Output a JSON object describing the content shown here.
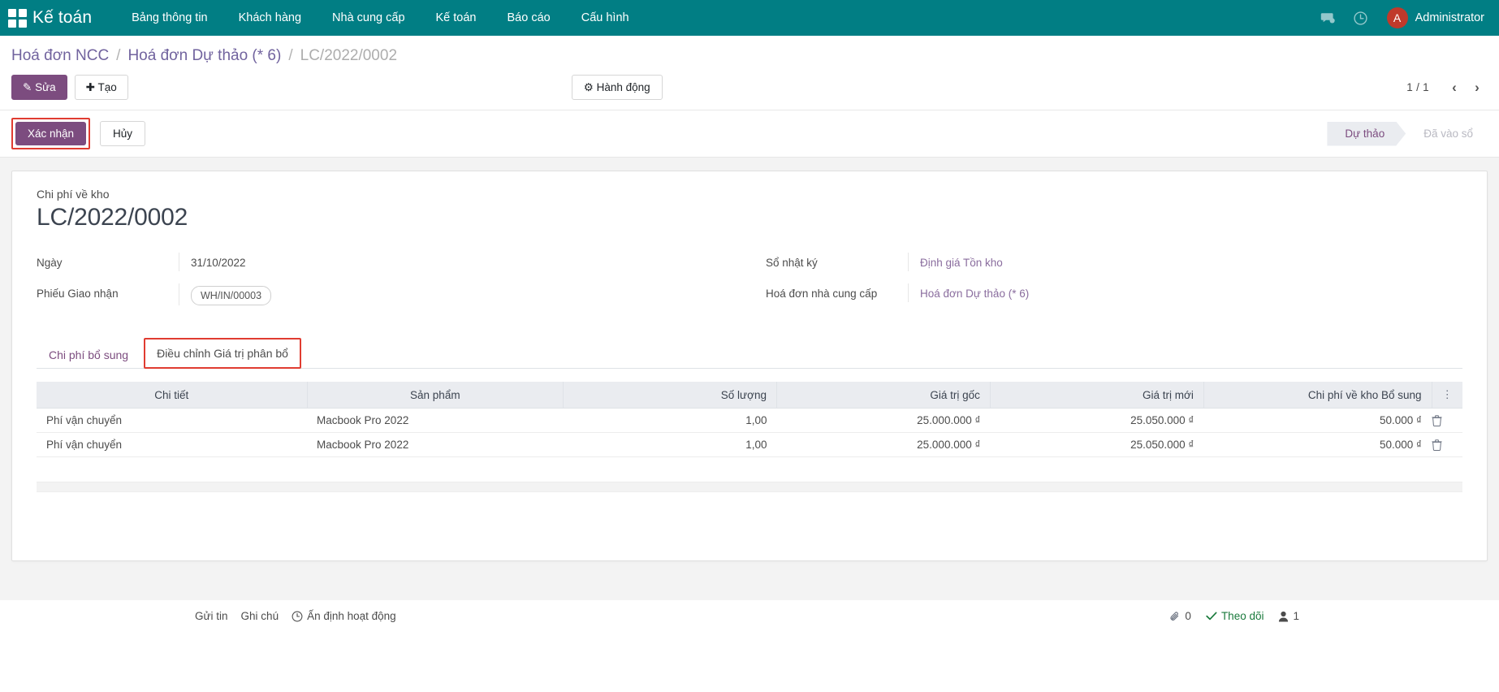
{
  "navbar": {
    "brand": "Kế toán",
    "apps_icon": "apps-grid-icon",
    "menu": [
      {
        "label": "Bảng thông tin"
      },
      {
        "label": "Khách hàng"
      },
      {
        "label": "Nhà cung cấp"
      },
      {
        "label": "Kế toán"
      },
      {
        "label": "Báo cáo"
      },
      {
        "label": "Cấu hình"
      }
    ],
    "messages_icon": "chat-bubble-icon",
    "activities_icon": "clock-icon",
    "avatar_initial": "A",
    "user_name": "Administrator",
    "bg_color": "#017e84",
    "avatar_color": "#c0392b"
  },
  "breadcrumb": {
    "items": [
      {
        "label": "Hoá đơn NCC",
        "current": false
      },
      {
        "label": "Hoá đơn Dự thảo (* 6)",
        "current": false
      },
      {
        "label": "LC/2022/0002",
        "current": true
      }
    ],
    "separator": "/"
  },
  "toolbar": {
    "edit_label": "Sửa",
    "edit_icon": "pencil-icon",
    "create_label": "Tạo",
    "create_icon": "plus-icon",
    "action_label": "Hành động",
    "action_icon": "gear-icon",
    "pager_count": "1 / 1",
    "pager_prev_icon": "chevron-left-icon",
    "pager_next_icon": "chevron-right-icon"
  },
  "statusbar": {
    "confirm_label": "Xác nhận",
    "cancel_label": "Hủy",
    "highlight_color": "#e03c31",
    "stages": [
      {
        "label": "Dự thảo",
        "active": true
      },
      {
        "label": "Đã vào sổ",
        "active": false
      }
    ]
  },
  "form": {
    "sublabel": "Chi phí về kho",
    "title": "LC/2022/0002",
    "left_fields": [
      {
        "label": "Ngày",
        "value": "31/10/2022",
        "type": "text"
      },
      {
        "label": "Phiếu Giao nhận",
        "value": "WH/IN/00003",
        "type": "badge"
      }
    ],
    "right_fields": [
      {
        "label": "Sổ nhật ký",
        "value": "Định giá Tồn kho",
        "type": "link"
      },
      {
        "label": "Hoá đơn nhà cung cấp",
        "value": "Hoá đơn Dự thảo (* 6)",
        "type": "link"
      }
    ]
  },
  "tabs": [
    {
      "label": "Chi phí bổ sung",
      "active": false
    },
    {
      "label": "Điều chỉnh Giá trị phân bổ",
      "active": true,
      "highlighted": true
    }
  ],
  "table": {
    "columns": [
      {
        "label": "Chi tiết",
        "align": "left"
      },
      {
        "label": "Sản phẩm",
        "align": "left"
      },
      {
        "label": "Số lượng",
        "align": "right"
      },
      {
        "label": "Giá trị gốc",
        "align": "right"
      },
      {
        "label": "Giá trị mới",
        "align": "right"
      },
      {
        "label": "Chi phí về kho Bổ sung",
        "align": "right"
      }
    ],
    "options_icon": "column-options-icon",
    "row_delete_icon": "trash-icon",
    "rows": [
      {
        "detail": "Phí vận chuyển",
        "product": "Macbook Pro 2022",
        "quantity": "1,00",
        "original_value": "25.000.000 ₫",
        "new_value": "25.050.000 ₫",
        "additional_landed_cost": "50.000 ₫"
      },
      {
        "detail": "Phí vận chuyển",
        "product": "Macbook Pro 2022",
        "quantity": "1,00",
        "original_value": "25.000.000 ₫",
        "new_value": "25.050.000 ₫",
        "additional_landed_cost": "50.000 ₫"
      }
    ]
  },
  "chatter": {
    "send_message_label": "Gửi tin",
    "log_note_label": "Ghi chú",
    "schedule_activity_label": "Ấn định hoạt động",
    "schedule_activity_icon": "clock-icon",
    "attachment_icon": "paperclip-icon",
    "attachment_count": "0",
    "following_icon": "check-icon",
    "following_label": "Theo dõi",
    "followers_icon": "user-icon",
    "followers_count": "1"
  }
}
